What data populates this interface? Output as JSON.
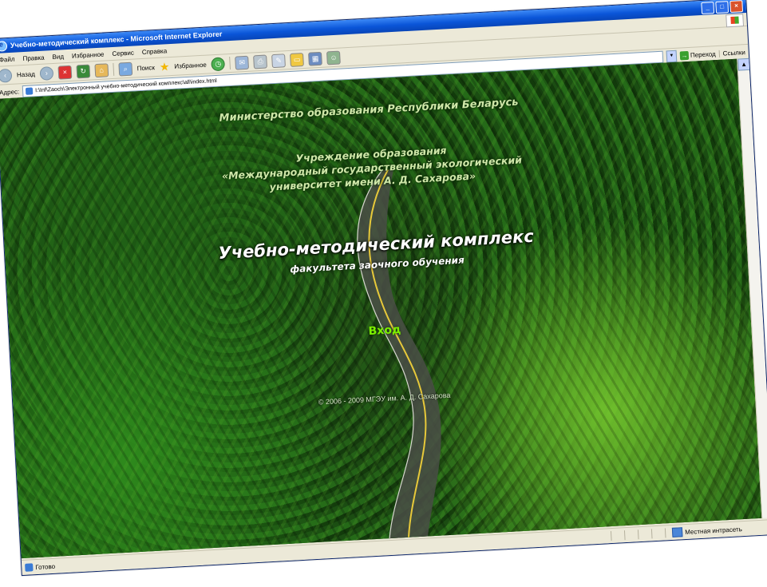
{
  "window": {
    "title": "Учебно-методический комплекс - Microsoft Internet Explorer",
    "buttons": {
      "minimize": "_",
      "maximize": "□",
      "close": "×"
    }
  },
  "menu": {
    "items": [
      "Файл",
      "Правка",
      "Вид",
      "Избранное",
      "Сервис",
      "Справка"
    ]
  },
  "toolbar": {
    "back_label": "Назад",
    "search_label": "Поиск",
    "favorites_label": "Избранное"
  },
  "address": {
    "label": "Адрес:",
    "value": "I:\\Inf\\Zaoch\\Электронный учебно-методический комплекс\\all\\index.html",
    "go_label": "Переход",
    "links_label": "Ссылки"
  },
  "page": {
    "ministry": "Министерство образования Республики Беларусь",
    "institution_line1": "Учреждение образования",
    "institution_line2": "«Международный государственный экологический",
    "institution_line3": "университет имени А. Д. Сахарова»",
    "title": "Учебно-методический комплекс",
    "subtitle": "факультета заочного обучения",
    "enter_link": "Вход",
    "copyright": "© 2006 - 2009 МГЭУ им. А. Д. Сахарова"
  },
  "status": {
    "text": "Готово",
    "zone": "Местная интрасеть"
  },
  "colors": {
    "enter_link": "#7cf000",
    "header_text": "#cfe7a8",
    "titlebar": "#0a55d8"
  }
}
